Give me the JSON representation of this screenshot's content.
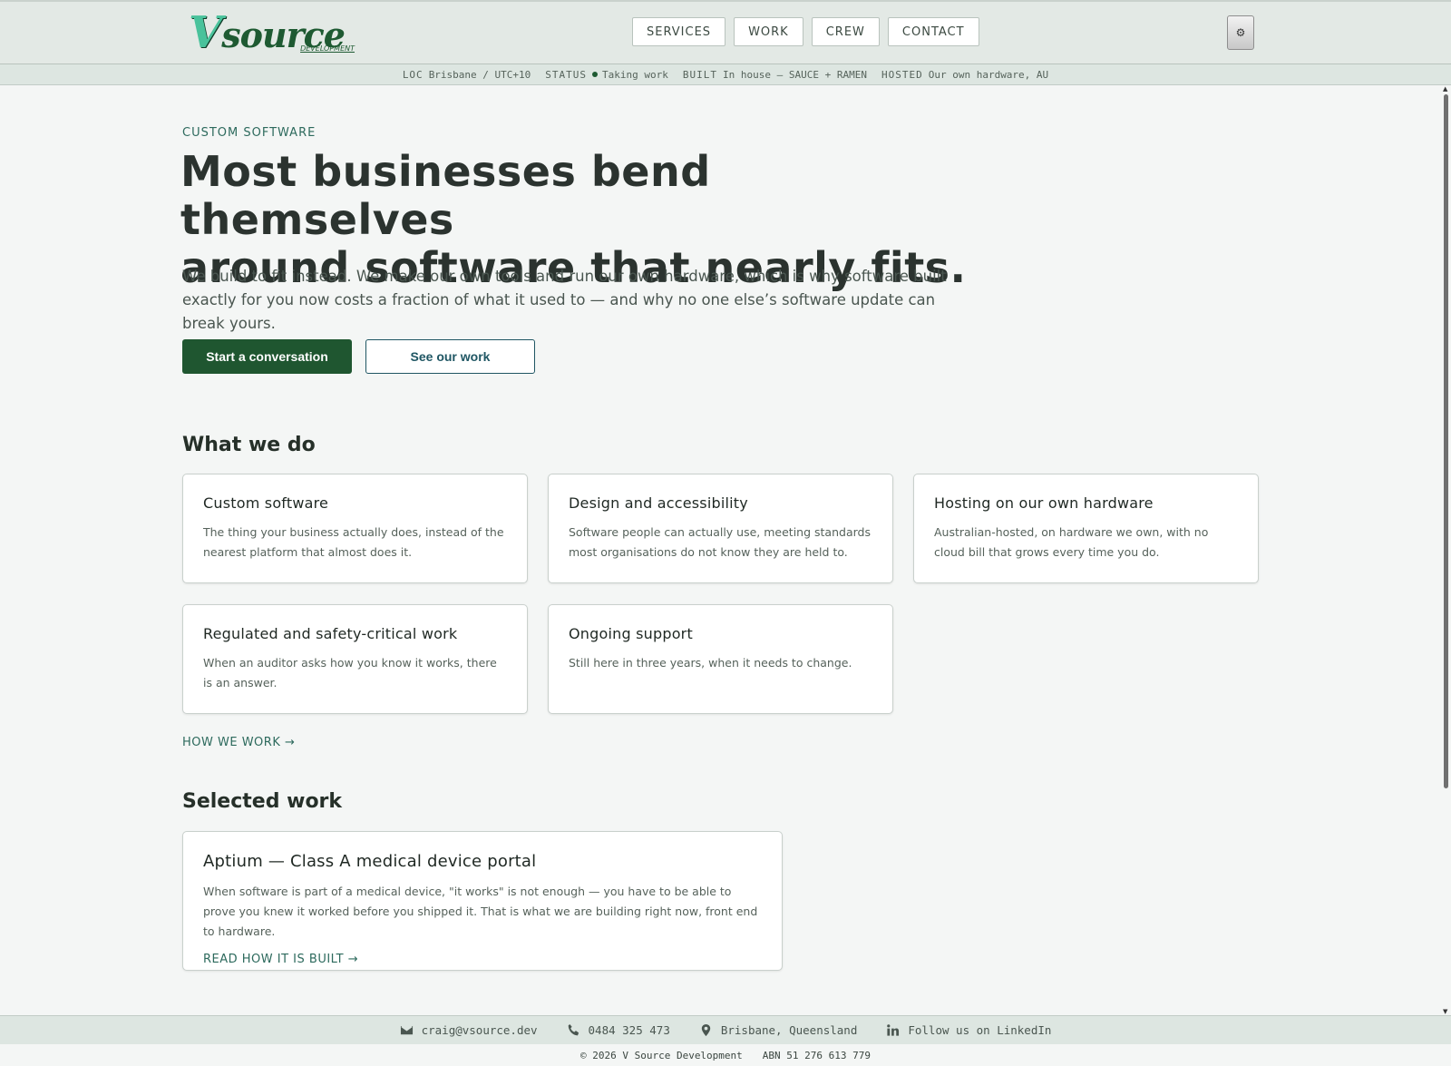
{
  "header": {
    "logo": {
      "mark": "V",
      "word": "source",
      "sub": "DEVELOPMENT"
    },
    "nav": [
      "SERVICES",
      "WORK",
      "CREW",
      "CONTACT"
    ],
    "theme_toggle_icon": "gear-icon",
    "theme_toggle_glyph": "⚙"
  },
  "status": {
    "loc_label": "LOC",
    "loc_value": "Brisbane / UTC+10",
    "status_label": "STATUS",
    "status_value": "Taking work",
    "built_label": "BUILT",
    "built_value": "In house — SAUCE + RAMEN",
    "hosted_label": "HOSTED",
    "hosted_value": "Our own hardware, AU"
  },
  "hero": {
    "eyebrow": "CUSTOM SOFTWARE",
    "headline_line1": "Most businesses bend themselves",
    "headline_line2": "around software that nearly fits.",
    "lede": "We build to fit instead. We make our own tools and run our own hardware, which is why software built exactly for you now costs a fraction of what it used to — and why no one else’s software update can break yours.",
    "primary_cta": "Start a conversation",
    "secondary_cta": "See our work"
  },
  "services": {
    "title": "What we do",
    "items": [
      {
        "title": "Custom software",
        "desc": "The thing your business actually does, instead of the nearest platform that almost does it."
      },
      {
        "title": "Design and accessibility",
        "desc": "Software people can actually use, meeting standards most organisations do not know they are held to."
      },
      {
        "title": "Hosting on our own hardware",
        "desc": "Australian-hosted, on hardware we own, with no cloud bill that grows every time you do."
      },
      {
        "title": "Regulated and safety-critical work",
        "desc": "When an auditor asks how you know it works, there is an answer."
      },
      {
        "title": "Ongoing support",
        "desc": "Still here in three years, when it needs to change."
      }
    ],
    "link": "HOW WE WORK →"
  },
  "work": {
    "title": "Selected work",
    "item": {
      "title": "Aptium — Class A medical device portal",
      "desc": "When software is part of a medical device, \"it works\" is not enough — you have to be able to prove you knew it worked before you shipped it. That is what we are building right now, front end to hardware.",
      "link": "READ HOW IT IS BUILT →"
    }
  },
  "footer": {
    "email": "craig@vsource.dev",
    "phone": "0484 325 473",
    "location": "Brisbane, Queensland",
    "linkedin": "Follow us on LinkedIn",
    "copyright": "© 2026 V Source Development",
    "abn": "ABN 51 276 613 779"
  },
  "colors": {
    "primary": "#1f5630",
    "accent": "#2d6a5d",
    "header_bg": "#e3e9e5",
    "page_bg": "#f4f6f5"
  }
}
